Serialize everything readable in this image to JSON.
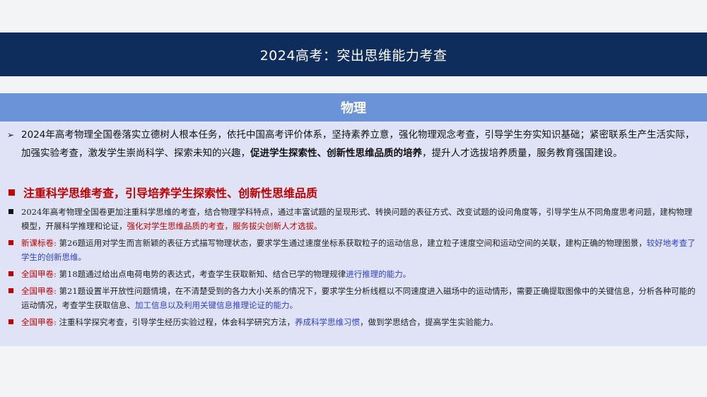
{
  "header": {
    "title": "2024高考：突出思维能力考查"
  },
  "section": {
    "label": "物理"
  },
  "intro": {
    "marker": "➢",
    "text_a": "2024年高考物理全国卷落实立德树人根本任务，依托中国高考评价体系，坚持素养立意，强化物理观念考查，引导学生夯实知识基础；紧密联系生产生活实际，加强实验考查，激发学生崇尚科学、探索未知的兴趣，",
    "text_bold": "促进学生探索性、创新性思维品质的培养",
    "text_b": "，提升人才选拔培养质量，服务教育强国建设。"
  },
  "heading": {
    "text": "注重科学思维考查，引导培养学生探索性、创新性思维品质"
  },
  "items": [
    {
      "prefix": "",
      "text": "2024年高考物理全国卷更加注重科学思维的考查，结合物理学科特点，通过丰富试题的呈现形式、转换问题的表征方式、改变试题的设问角度等，引导学生从不同角度思考问题，建构物理模型，开展科学推理和论证，",
      "highlight": "强化对学生思维品质的考查，服务拔尖创新人才选拔。"
    },
    {
      "prefix": "新课标卷:",
      "text": "第26题运用对学生而言新颖的表征方式描写物理状态，要求学生通过速度坐标系获取粒子的运动信息，建立粒子速度空间和运动空间的关联，建构正确的物理图景，",
      "highlight": "较好地考查了学生的创新思维。"
    },
    {
      "prefix": "全国甲卷:",
      "text": "第18题通过给出点电荷电势的表达式，考查学生获取新知、结合已学的物理规律",
      "highlight": "进行推理的能力。"
    },
    {
      "prefix": "全国甲卷:",
      "text": "第21题设置半开放性问题情境，在不清楚受到的各力大小关系的情况下，要求学生分析线框以不同速度进入磁场中的运动情形，需要正确提取图像中的关键信息，分析各种可能的运动情况，考查学生获取信息、",
      "highlight": "加工信息以及利用关键信息推理论证的能力。"
    },
    {
      "prefix": "全国甲卷:",
      "text": "注重科学探究考查，引导学生经历实验过程，体会科学研究方法，",
      "highlight": "养成科学思维习惯",
      "tail": "，做到学思结合，提高学生实验能力。"
    }
  ],
  "colors": {
    "header_bg": "#0f2d5c",
    "subhead_bg": "#6b93d7",
    "panel_bg": "#dfe3f5",
    "accent_red": "#c00000",
    "accent_blue": "#2f3fd0"
  }
}
